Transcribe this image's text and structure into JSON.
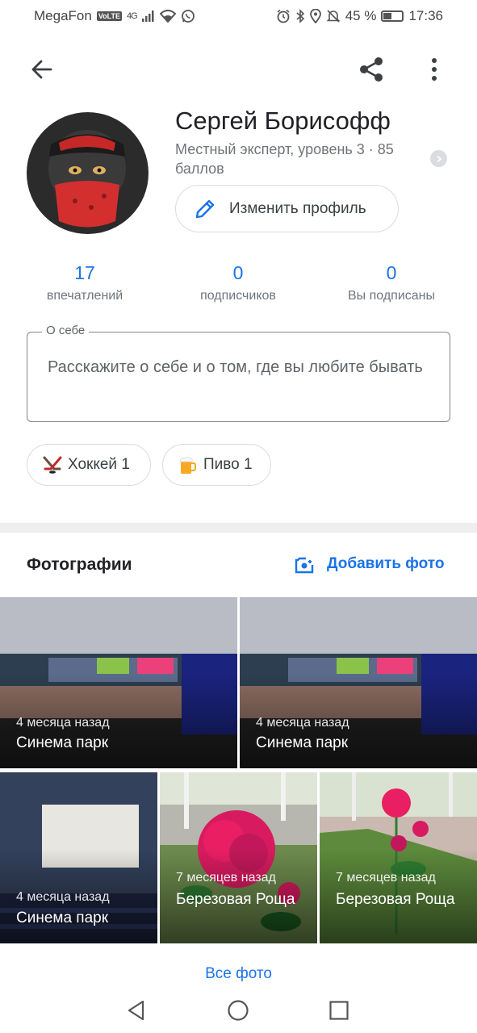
{
  "status_bar": {
    "carrier": "MegaFon",
    "volte": "VoLTE",
    "network": "4G",
    "battery": "45 %",
    "battery_level": 0.45,
    "time": "17:36"
  },
  "app_bar": {
    "icons": [
      "arrow-back-icon",
      "share-icon",
      "more-vert-icon"
    ]
  },
  "profile": {
    "name": "Сергей Борисофф",
    "level": "Местный эксперт, уровень 3 · 85 баллов",
    "edit_label": "Изменить профиль"
  },
  "stats": [
    {
      "value": "17",
      "label": "впечатлений"
    },
    {
      "value": "0",
      "label": "подписчиков"
    },
    {
      "value": "0",
      "label": "Вы подписаны"
    }
  ],
  "about": {
    "label": "О себе",
    "placeholder": "Расскажите о себе и о том, где вы любите бывать"
  },
  "interests": [
    {
      "icon": "hockey-icon",
      "label": "Хоккей 1"
    },
    {
      "icon": "beer-icon",
      "label": "Пиво 1"
    }
  ],
  "photos": {
    "title": "Фотографии",
    "add_label": "Добавить фото",
    "items": [
      {
        "time": "4 месяца назад",
        "place": "Синема парк"
      },
      {
        "time": "4 месяца назад",
        "place": "Синема парк"
      },
      {
        "time": "4 месяца назад",
        "place": "Синема парк"
      },
      {
        "time": "7 месяцев назад",
        "place": "Березовая Роща"
      },
      {
        "time": "7 месяцев назад",
        "place": "Березовая Роща"
      }
    ],
    "all_label": "Все фото"
  },
  "colors": {
    "accent": "#1a73e8",
    "text_primary": "#202124",
    "text_secondary": "#70757a"
  }
}
